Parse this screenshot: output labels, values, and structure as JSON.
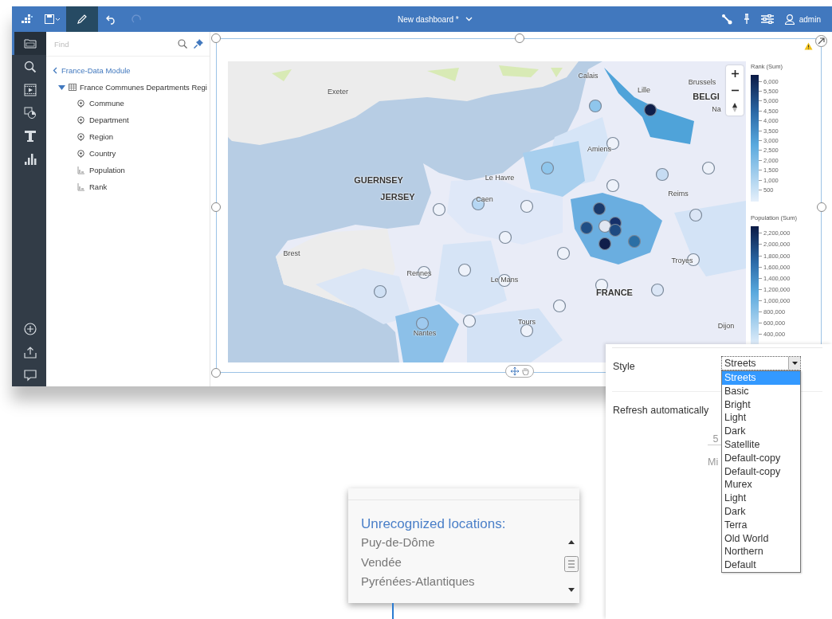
{
  "toolbar": {
    "title": "New dashboard *",
    "user": "admin",
    "edit_mode": true,
    "redo_disabled": true
  },
  "rail": [
    {
      "kind": "data",
      "selected": true
    },
    {
      "kind": "search",
      "selected": false
    },
    {
      "kind": "media",
      "selected": false
    },
    {
      "kind": "shapes",
      "selected": false
    },
    {
      "kind": "text",
      "selected": false
    },
    {
      "kind": "chart",
      "selected": false
    },
    {
      "kind": "add",
      "selected": false
    },
    {
      "kind": "share",
      "selected": false
    },
    {
      "kind": "comment",
      "selected": false
    }
  ],
  "data_panel": {
    "search_placeholder": "Find",
    "module": "France-Data Module",
    "tree": [
      {
        "label": "France Communes Departments Regi",
        "expanded": true,
        "children": [
          {
            "label": "Commune",
            "kind": "location"
          },
          {
            "label": "Department",
            "kind": "location"
          },
          {
            "label": "Region",
            "kind": "location"
          },
          {
            "label": "Country",
            "kind": "location"
          },
          {
            "label": "Population",
            "kind": "measure"
          },
          {
            "label": "Rank",
            "kind": "measure"
          }
        ]
      }
    ]
  },
  "map": {
    "labels": [
      {
        "text": "Exeter",
        "kind": "city"
      },
      {
        "text": "Calais",
        "kind": "city"
      },
      {
        "text": "Brussels",
        "kind": "city"
      },
      {
        "text": "BELGI",
        "kind": "country"
      },
      {
        "text": "Na",
        "kind": "city"
      },
      {
        "text": "Lille",
        "kind": "city"
      },
      {
        "text": "Amiens",
        "kind": "city"
      },
      {
        "text": "GUERNSEY",
        "kind": "country"
      },
      {
        "text": "JERSEY",
        "kind": "country"
      },
      {
        "text": "Le Havre",
        "kind": "city"
      },
      {
        "text": "Caen",
        "kind": "city"
      },
      {
        "text": "Reims",
        "kind": "city"
      },
      {
        "text": "Brest",
        "kind": "city"
      },
      {
        "text": "Rennes",
        "kind": "city"
      },
      {
        "text": "Le Mans",
        "kind": "city"
      },
      {
        "text": "Troyes",
        "kind": "city"
      },
      {
        "text": "FRANCE",
        "kind": "country"
      },
      {
        "text": "Tours",
        "kind": "city"
      },
      {
        "text": "Nantes",
        "kind": "city"
      },
      {
        "text": "Dijon",
        "kind": "city"
      }
    ],
    "legends": [
      {
        "title": "Rank (Sum)",
        "ticks": [
          "6,000",
          "5,500",
          "5,000",
          "4,500",
          "4,000",
          "3,500",
          "3,000",
          "2,500",
          "2,000",
          "1,500",
          "1,000",
          "500"
        ]
      },
      {
        "title": "Population (Sum)",
        "ticks": [
          "2,200,000",
          "2,000,000",
          "1,800,000",
          "1,600,000",
          "1,400,000",
          "1,200,000",
          "1,000,000",
          "800,000",
          "600,000",
          "400,000"
        ]
      }
    ]
  },
  "properties": {
    "style_label": "Style",
    "style_value": "Streets",
    "style_options": [
      {
        "label": "Streets",
        "selected": true
      },
      {
        "label": "Basic",
        "selected": false
      },
      {
        "label": "Bright",
        "selected": false
      },
      {
        "label": "Light",
        "selected": false
      },
      {
        "label": "Dark",
        "selected": false
      },
      {
        "label": "Satellite",
        "selected": false
      },
      {
        "label": "Default-copy",
        "selected": false
      },
      {
        "label": "Default-copy",
        "selected": false
      },
      {
        "label": "Murex",
        "selected": false
      },
      {
        "label": "Light",
        "selected": false
      },
      {
        "label": "Dark",
        "selected": false
      },
      {
        "label": "Terra",
        "selected": false
      },
      {
        "label": "Old World",
        "selected": false
      },
      {
        "label": "Northern",
        "selected": false
      },
      {
        "label": "Default",
        "selected": false
      }
    ],
    "refresh_label": "Refresh automatically",
    "interval_value": "5",
    "interval_unit": "Mi"
  },
  "unrecognized": {
    "title": "Unrecognized locations:",
    "items": [
      "Puy-de-Dôme",
      "Vendée",
      "Pyrénées-Atlantiques"
    ]
  }
}
